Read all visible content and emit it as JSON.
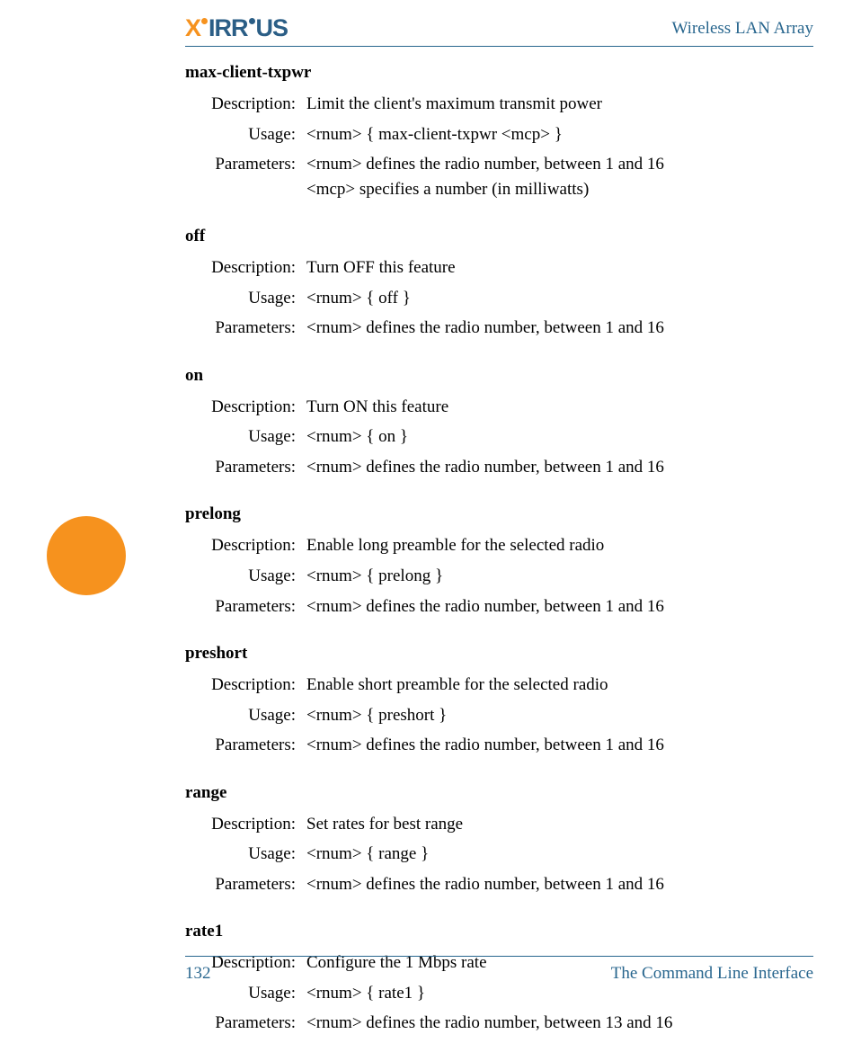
{
  "header": {
    "title": "Wireless LAN Array"
  },
  "commands": [
    {
      "name": "max-client-txpwr",
      "description": "Limit the client's maximum transmit power",
      "usage": "<rnum> { max-client-txpwr <mcp> }",
      "parameters": "<rnum> defines the radio number, between 1 and 16\n<mcp> specifies a number (in milliwatts)"
    },
    {
      "name": "off",
      "description": "Turn OFF this feature",
      "usage": "<rnum> { off }",
      "parameters": "<rnum> defines the radio number, between 1 and 16"
    },
    {
      "name": "on",
      "description": "Turn ON this feature",
      "usage": "<rnum> { on }",
      "parameters": "<rnum> defines the radio number, between 1 and 16"
    },
    {
      "name": "prelong",
      "description": "Enable long preamble for the selected radio",
      "usage": "<rnum> { prelong }",
      "parameters": "<rnum> defines the radio number, between 1 and 16"
    },
    {
      "name": "preshort",
      "description": "Enable short preamble for the selected radio",
      "usage": "<rnum> { preshort }",
      "parameters": "<rnum> defines the radio number, between 1 and 16"
    },
    {
      "name": "range",
      "description": "Set rates for best range",
      "usage": "<rnum> { range }",
      "parameters": "<rnum> defines the radio number, between 1 and 16"
    },
    {
      "name": "rate1",
      "description": "Configure the 1 Mbps rate",
      "usage": "<rnum> { rate1 }",
      "parameters": "<rnum> defines the radio number, between 13 and 16"
    }
  ],
  "labels": {
    "description": "Description:",
    "usage": "Usage:",
    "parameters": "Parameters:"
  },
  "footer": {
    "page_number": "132",
    "section": "The Command Line Interface"
  }
}
